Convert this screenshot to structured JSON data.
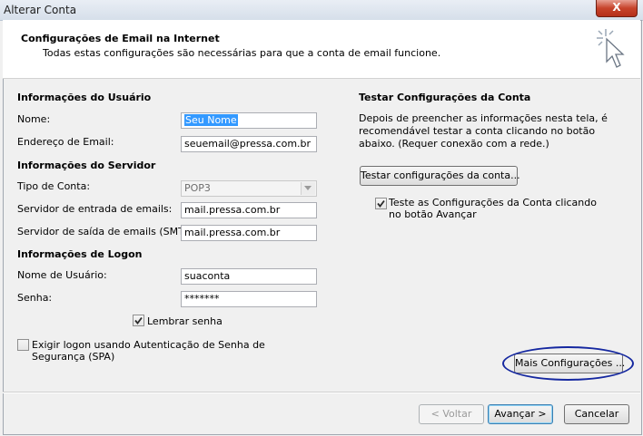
{
  "window": {
    "title": "Alterar Conta",
    "close_label": "X"
  },
  "header": {
    "title": "Configurações de Email na Internet",
    "subtitle": "Todas estas configurações são necessárias para que a conta de email funcione."
  },
  "user_info": {
    "heading": "Informações do Usuário",
    "name_label": "Nome:",
    "name_value": "Seu Nome",
    "email_label": "Endereço de Email:",
    "email_value": "seuemail@pressa.com.br"
  },
  "server_info": {
    "heading": "Informações do Servidor",
    "account_type_label": "Tipo de Conta:",
    "account_type_value": "POP3",
    "incoming_label": "Servidor de entrada de emails:",
    "incoming_value": "mail.pressa.com.br",
    "outgoing_label": "Servidor de saída de emails (SMTP):",
    "outgoing_value": "mail.pressa.com.br"
  },
  "logon_info": {
    "heading": "Informações de Logon",
    "username_label": "Nome de Usuário:",
    "username_value": "suaconta",
    "password_label": "Senha:",
    "password_value": "*******",
    "remember_label": "Lembrar senha",
    "remember_checked": true,
    "spa_label": "Exigir logon usando Autenticação de Senha de Segurança (SPA)",
    "spa_checked": false
  },
  "test": {
    "heading": "Testar Configurações da Conta",
    "description": "Depois de preencher as informações nesta tela, é recomendável testar a conta clicando no botão abaixo. (Requer conexão com a rede.)",
    "test_button": "Testar configurações da conta...",
    "auto_test_label": "Teste as Configurações da Conta clicando no botão Avançar",
    "auto_test_checked": true
  },
  "more_settings_button": "Mais Configurações ...",
  "footer": {
    "back": "< Voltar",
    "next": "Avançar >",
    "cancel": "Cancelar"
  },
  "colors": {
    "highlight": "#3399ff",
    "annotation_ellipse": "#1528a0",
    "close_button": "#c7432b"
  }
}
